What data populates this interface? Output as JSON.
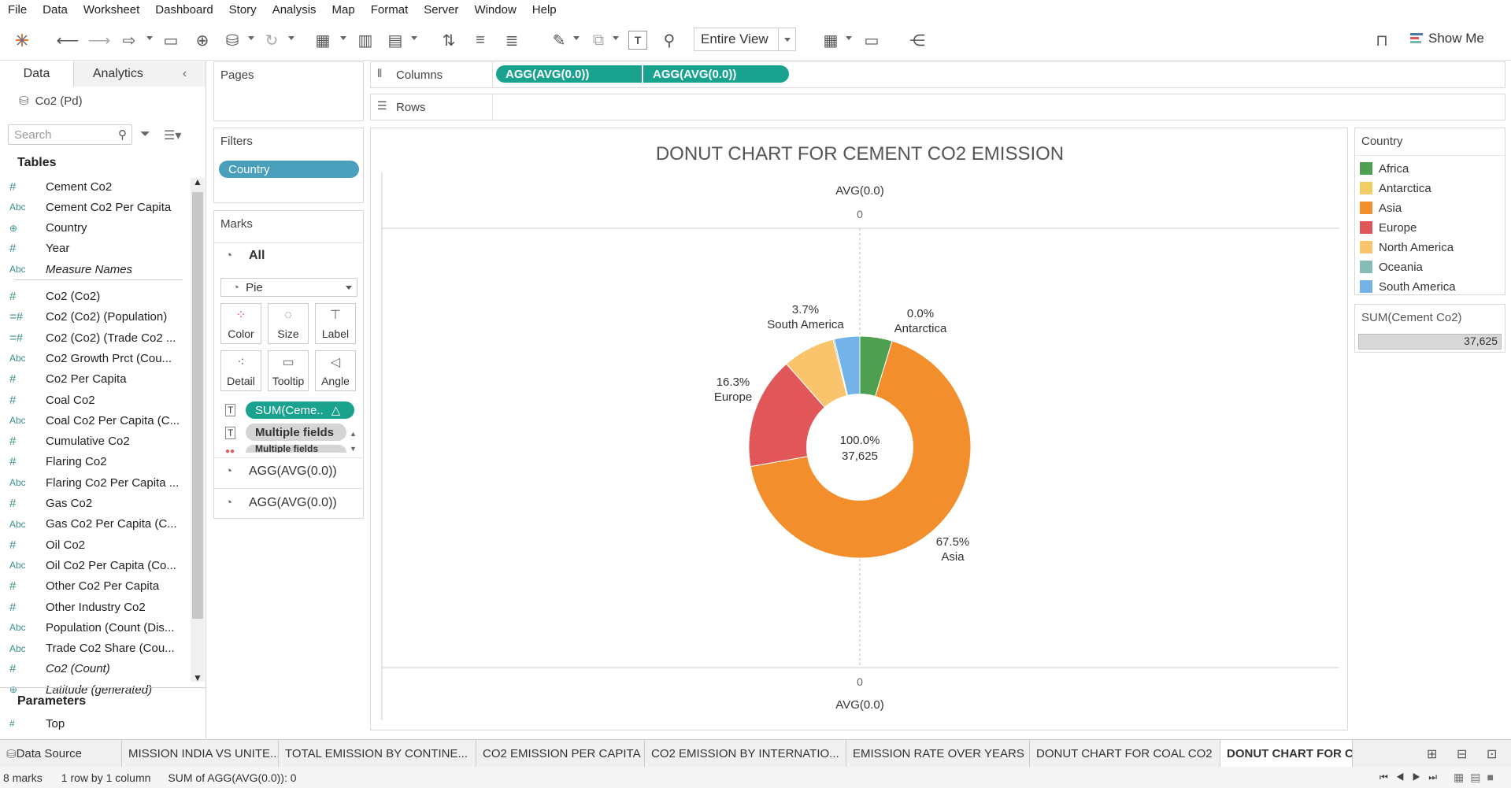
{
  "menu": [
    "File",
    "Data",
    "Worksheet",
    "Dashboard",
    "Story",
    "Analysis",
    "Map",
    "Format",
    "Server",
    "Window",
    "Help"
  ],
  "toolbar": {
    "view_value": "Entire View",
    "show_me": "Show Me"
  },
  "datapane": {
    "tabs": [
      "Data",
      "Analytics"
    ],
    "datasource": "Co2 (Pd)",
    "search_placeholder": "Search",
    "tables_heading": "Tables",
    "fields": [
      {
        "type": "#",
        "name": "Cement Co2",
        "italic": false
      },
      {
        "type": "Abc",
        "name": "Cement Co2 Per Capita",
        "italic": false
      },
      {
        "type": "globe",
        "name": "Country",
        "italic": false
      },
      {
        "type": "#",
        "name": "Year",
        "italic": false
      },
      {
        "type": "Abc",
        "name": "Measure Names",
        "italic": true
      },
      {
        "type": "#",
        "name": "Co2 (Co2)",
        "italic": false
      },
      {
        "type": "=#",
        "name": "Co2 (Co2) (Population)",
        "italic": false
      },
      {
        "type": "=#",
        "name": "Co2 (Co2) (Trade Co2 ...",
        "italic": false
      },
      {
        "type": "Abc",
        "name": "Co2 Growth Prct (Cou...",
        "italic": false
      },
      {
        "type": "#",
        "name": "Co2 Per Capita",
        "italic": false
      },
      {
        "type": "#",
        "name": "Coal Co2",
        "italic": false
      },
      {
        "type": "Abc",
        "name": "Coal Co2 Per Capita (C...",
        "italic": false
      },
      {
        "type": "#",
        "name": "Cumulative Co2",
        "italic": false
      },
      {
        "type": "#",
        "name": "Flaring Co2",
        "italic": false
      },
      {
        "type": "Abc",
        "name": "Flaring Co2 Per Capita ...",
        "italic": false
      },
      {
        "type": "#",
        "name": "Gas Co2",
        "italic": false
      },
      {
        "type": "Abc",
        "name": "Gas Co2 Per Capita (C...",
        "italic": false
      },
      {
        "type": "#",
        "name": "Oil Co2",
        "italic": false
      },
      {
        "type": "Abc",
        "name": "Oil Co2 Per Capita (Co...",
        "italic": false
      },
      {
        "type": "#",
        "name": "Other Co2 Per Capita",
        "italic": false
      },
      {
        "type": "#",
        "name": "Other Industry Co2",
        "italic": false
      },
      {
        "type": "Abc",
        "name": "Population (Count (Dis...",
        "italic": false
      },
      {
        "type": "Abc",
        "name": "Trade Co2 Share (Cou...",
        "italic": false
      },
      {
        "type": "#",
        "name": "Co2 (Count)",
        "italic": true
      },
      {
        "type": "globe",
        "name": "Latitude (generated)",
        "italic": true
      }
    ],
    "parameters_heading": "Parameters",
    "parameters": [
      {
        "type": "#",
        "name": "Top"
      }
    ]
  },
  "shelves": {
    "pages": "Pages",
    "filters": "Filters",
    "filter_pill": "Country",
    "marks": "Marks",
    "marks_all": "All",
    "mark_type": "Pie",
    "mark_buttons": [
      "Color",
      "Size",
      "Label",
      "Detail",
      "Tooltip",
      "Angle"
    ],
    "mark_pills": [
      "SUM(Ceme..",
      "Multiple fields",
      "Multiple fields"
    ],
    "agg_rows": [
      "AGG(AVG(0.0))",
      "AGG(AVG(0.0))"
    ],
    "columns": "Columns",
    "column_pills": [
      "AGG(AVG(0.0))",
      "AGG(AVG(0.0))"
    ],
    "rows": "Rows"
  },
  "chart": {
    "axis_label": "AVG(0.0)",
    "axis_tick": "0",
    "center_pct": "100.0%",
    "center_value": "37,625"
  },
  "chart_data": {
    "type": "pie",
    "title": "DONUT CHART FOR CEMENT CO2 EMISSION",
    "categories": [
      "Africa",
      "Antarctica",
      "Asia",
      "Europe",
      "North America",
      "Oceania",
      "South America"
    ],
    "values": [
      4.7,
      0.0,
      67.5,
      16.3,
      7.6,
      0.2,
      3.7
    ],
    "labels": [
      {
        "pct": "0.0%",
        "name": "Antarctica"
      },
      {
        "pct": "67.5%",
        "name": "Asia"
      },
      {
        "pct": "16.3%",
        "name": "Europe"
      },
      {
        "pct": "3.7%",
        "name": "South America"
      }
    ],
    "colors": [
      "#4e9f50",
      "#f1ce63",
      "#f28e2b",
      "#e15759",
      "#f9c46b",
      "#86bcb6",
      "#73b3e8"
    ]
  },
  "legend": {
    "title": "Country",
    "items": [
      {
        "name": "Africa",
        "color": "#4e9f50"
      },
      {
        "name": "Antarctica",
        "color": "#f1ce63"
      },
      {
        "name": "Asia",
        "color": "#f28e2b"
      },
      {
        "name": "Europe",
        "color": "#e15759"
      },
      {
        "name": "North America",
        "color": "#f9c46b"
      },
      {
        "name": "Oceania",
        "color": "#86bcb6"
      },
      {
        "name": "South America",
        "color": "#73b3e8"
      }
    ],
    "filter_title": "SUM(Cement Co2)",
    "filter_value": "37,625"
  },
  "sheet_tabs": [
    "Data Source",
    "MISSION INDIA VS UNITE...",
    "TOTAL EMISSION BY CONTINE...",
    "CO2 EMISSION PER CAPITA",
    "CO2 EMISSION BY INTERNATIO...",
    "EMISSION RATE OVER YEARS",
    "DONUT CHART FOR COAL CO2",
    "DONUT CHART FOR CEMENT ..."
  ],
  "status": {
    "marks": "8 marks",
    "rows": "1 row by 1 column",
    "sum": "SUM of AGG(AVG(0.0)): 0"
  }
}
